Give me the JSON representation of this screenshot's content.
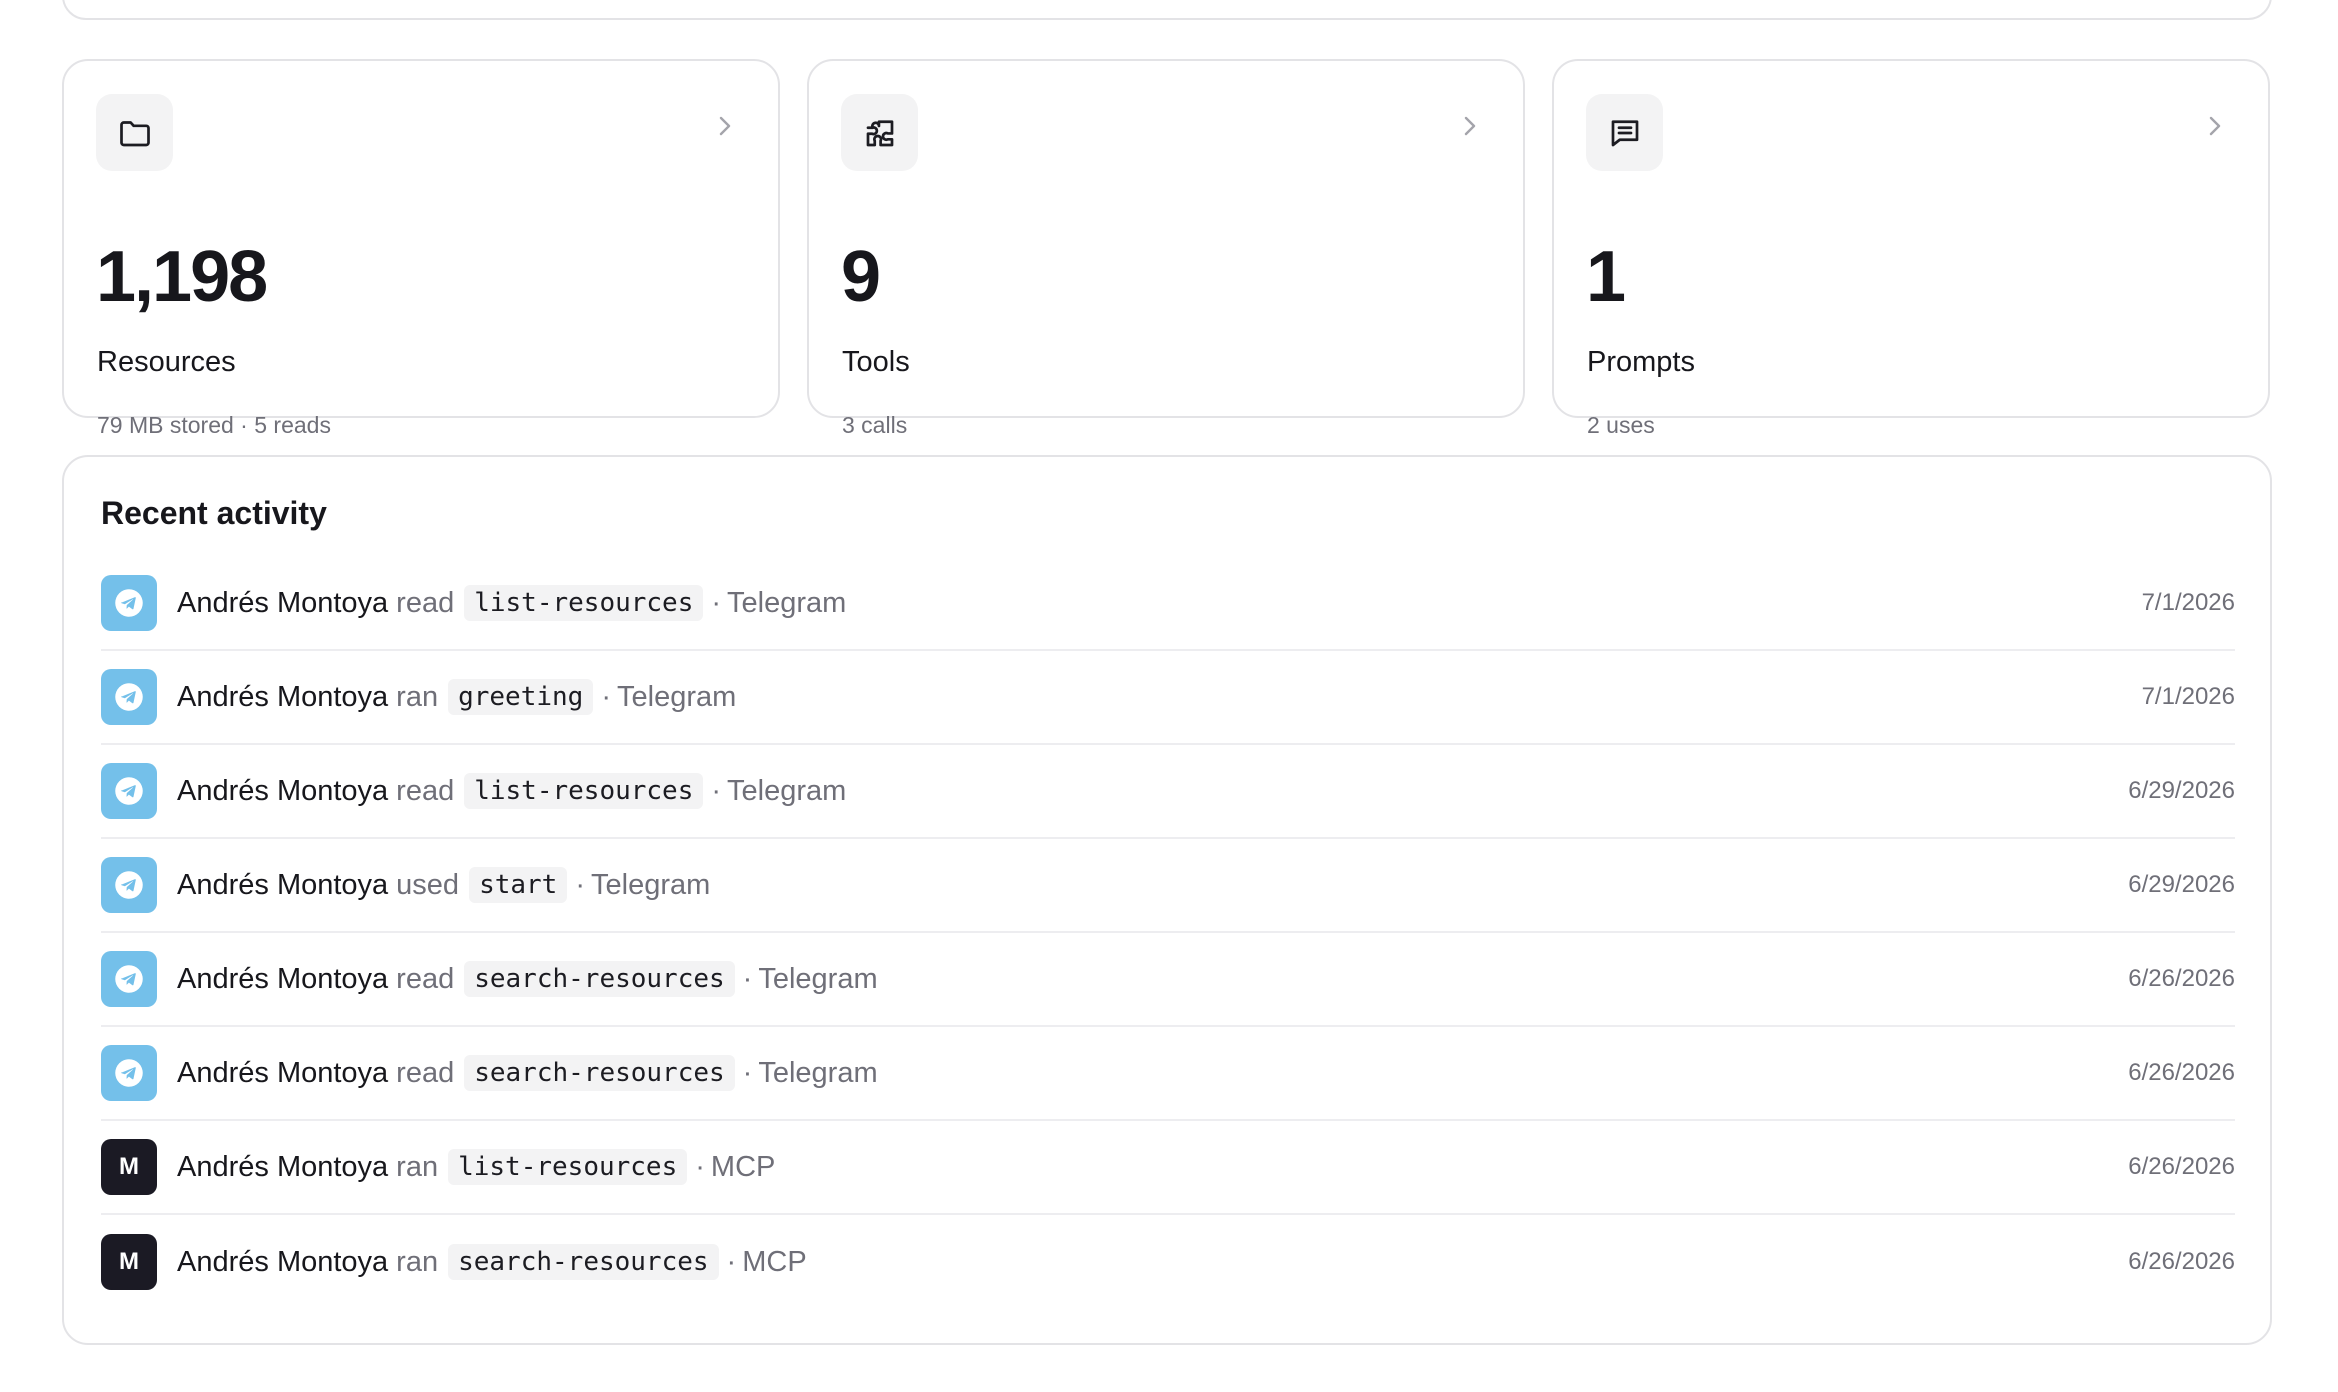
{
  "stats": [
    {
      "icon": "folder-icon",
      "value": "1,198",
      "label": "Resources",
      "sub": "79 MB stored · 5 reads"
    },
    {
      "icon": "puzzle-icon",
      "value": "9",
      "label": "Tools",
      "sub": "3 calls"
    },
    {
      "icon": "message-icon",
      "value": "1",
      "label": "Prompts",
      "sub": "2 uses"
    }
  ],
  "activity": {
    "title": "Recent activity",
    "items": [
      {
        "avatar": "telegram",
        "avatar_text": "",
        "actor": "Andrés Montoya",
        "verb": "read",
        "resource": "list-resources",
        "sep": "·",
        "source": "Telegram",
        "date": "7/1/2026"
      },
      {
        "avatar": "telegram",
        "avatar_text": "",
        "actor": "Andrés Montoya",
        "verb": "ran",
        "resource": "greeting",
        "sep": "·",
        "source": "Telegram",
        "date": "7/1/2026"
      },
      {
        "avatar": "telegram",
        "avatar_text": "",
        "actor": "Andrés Montoya",
        "verb": "read",
        "resource": "list-resources",
        "sep": "·",
        "source": "Telegram",
        "date": "6/29/2026"
      },
      {
        "avatar": "telegram",
        "avatar_text": "",
        "actor": "Andrés Montoya",
        "verb": "used",
        "resource": "start",
        "sep": "·",
        "source": "Telegram",
        "date": "6/29/2026"
      },
      {
        "avatar": "telegram",
        "avatar_text": "",
        "actor": "Andrés Montoya",
        "verb": "read",
        "resource": "search-resources",
        "sep": "·",
        "source": "Telegram",
        "date": "6/26/2026"
      },
      {
        "avatar": "telegram",
        "avatar_text": "",
        "actor": "Andrés Montoya",
        "verb": "read",
        "resource": "search-resources",
        "sep": "·",
        "source": "Telegram",
        "date": "6/26/2026"
      },
      {
        "avatar": "mcp",
        "avatar_text": "M",
        "actor": "Andrés Montoya",
        "verb": "ran",
        "resource": "list-resources",
        "sep": "·",
        "source": "MCP",
        "date": "6/26/2026"
      },
      {
        "avatar": "mcp",
        "avatar_text": "M",
        "actor": "Andrés Montoya",
        "verb": "ran",
        "resource": "search-resources",
        "sep": "·",
        "source": "MCP",
        "date": "6/26/2026"
      }
    ]
  },
  "colors": {
    "telegram": "#74c0ea",
    "mcp": "#1b1a24",
    "border": "#e3e3e6",
    "muted_text": "#6f6f78"
  }
}
